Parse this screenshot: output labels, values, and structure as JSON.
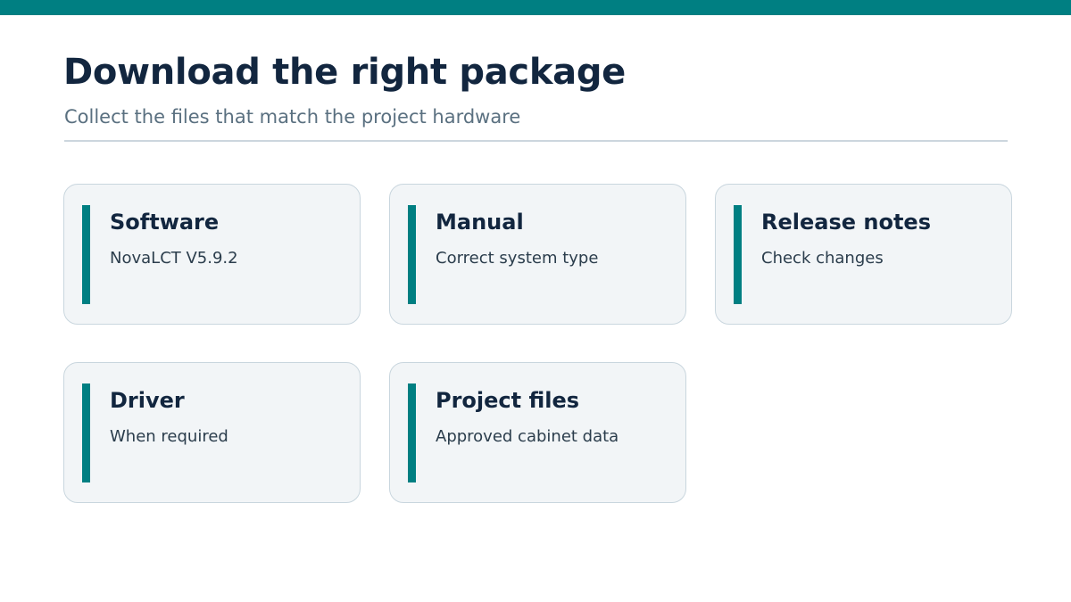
{
  "header": {
    "title": "Download the right package",
    "subtitle": "Collect the files that match the project hardware"
  },
  "colors": {
    "accent": "#007f82",
    "title": "#12263f",
    "subtitle": "#5a7080",
    "card_background": "#f2f5f7",
    "card_border": "#c9d6de"
  },
  "cards": [
    {
      "title": "Software",
      "description": "NovaLCT V5.9.2"
    },
    {
      "title": "Manual",
      "description": "Correct system type"
    },
    {
      "title": "Release notes",
      "description": "Check changes"
    },
    {
      "title": "Driver",
      "description": "When required"
    },
    {
      "title": "Project files",
      "description": "Approved cabinet data"
    }
  ]
}
